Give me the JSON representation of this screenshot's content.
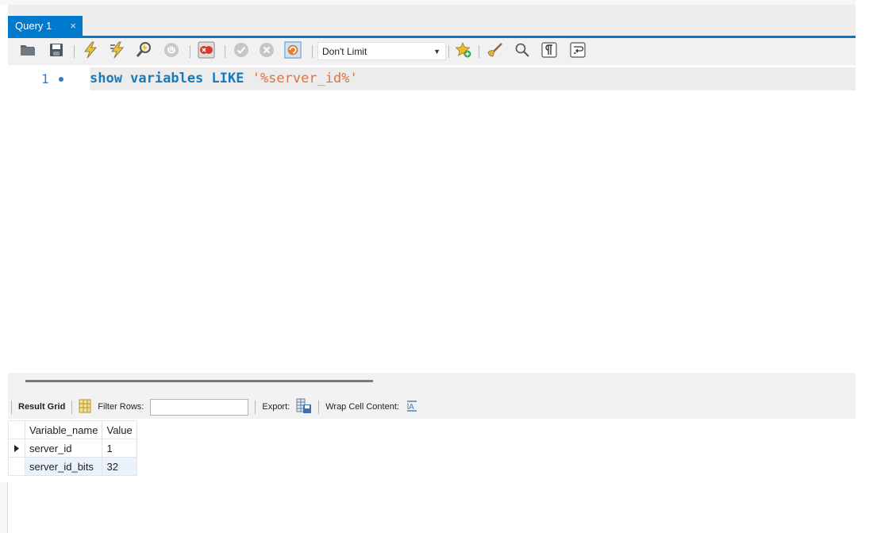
{
  "tab": {
    "label": "Query 1",
    "close": "×"
  },
  "toolbar": {
    "limit_value": "Don't Limit",
    "icons": [
      "folder-open-icon",
      "save-icon",
      "execute-icon",
      "execute-current-icon",
      "explain-icon",
      "stop-icon",
      "toggle-error-icon",
      "commit-icon",
      "rollback-icon",
      "autocommit-icon",
      "add-snippet-icon",
      "beautify-icon",
      "find-icon",
      "invisible-chars-icon",
      "wrap-lines-icon"
    ]
  },
  "editor": {
    "line_number": "1",
    "sql_keywords": "show variables LIKE ",
    "sql_string": "'%server_id%'"
  },
  "results": {
    "result_grid_label": "Result Grid",
    "filter_label": "Filter Rows:",
    "filter_value": "",
    "export_label": "Export:",
    "wrap_label": "Wrap Cell Content:",
    "columns": [
      "Variable_name",
      "Value"
    ],
    "rows": [
      {
        "name": "server_id",
        "value": "1"
      },
      {
        "name": "server_id_bits",
        "value": "32"
      }
    ]
  },
  "colors": {
    "accent": "#007acc",
    "keyword": "#1a79b8",
    "string": "#e2723b",
    "row_alt": "#e9f2fb"
  }
}
